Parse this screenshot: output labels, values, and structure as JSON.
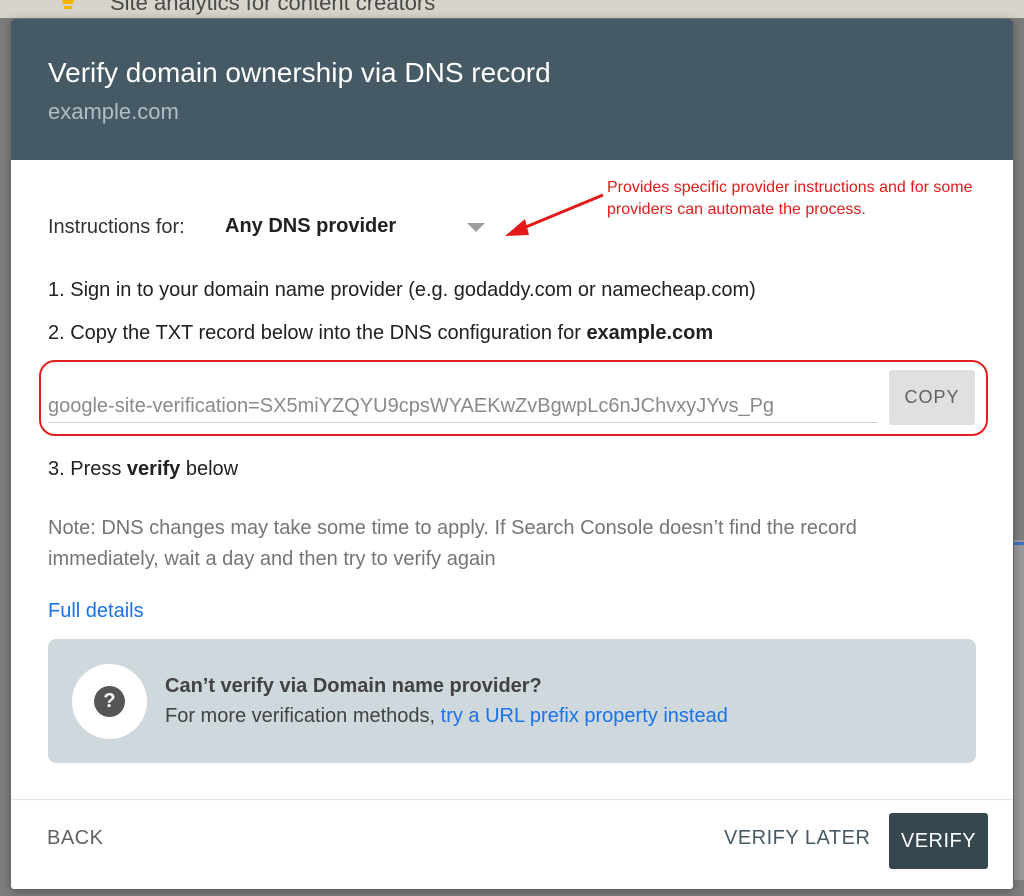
{
  "background": {
    "title": "Site analytics for content creators"
  },
  "dialog": {
    "title": "Verify domain ownership via DNS record",
    "subtitle": "example.com",
    "instructions_label": "Instructions for:",
    "provider_value": "Any DNS provider",
    "annotation": "Provides specific provider instructions and for some providers can automate the process.",
    "step1": "1. Sign in to your domain name provider (e.g. godaddy.com or namecheap.com)",
    "step2_prefix": "2. Copy the TXT record below into the DNS configuration for ",
    "step2_domain": "example.com",
    "txt_record": "google-site-verification=SX5miYZQYU9cpsWYAEKwZvBgwpLc6nJChvxyJYvs_Pg",
    "copy_label": "COPY",
    "step3_prefix": "3. Press ",
    "step3_bold": "verify",
    "step3_suffix": " below",
    "note": "Note: DNS changes may take some time to apply. If Search Console doesn’t find the record immediately, wait a day and then try to verify again",
    "full_details": "Full details",
    "alt": {
      "title": "Can’t verify via Domain name provider?",
      "text_prefix": "For more verification methods, ",
      "link": "try a URL prefix property instead"
    },
    "footer": {
      "back": "BACK",
      "verify_later": "VERIFY LATER",
      "verify": "VERIFY"
    }
  },
  "colors": {
    "header_bg": "#455a64",
    "link": "#1a73e8",
    "annotation": "#e21a1a",
    "verify_bg": "#37474f"
  },
  "icons": [
    "lightbulb-icon",
    "dropdown-caret-icon",
    "help-icon",
    "annotation-arrow-icon"
  ]
}
